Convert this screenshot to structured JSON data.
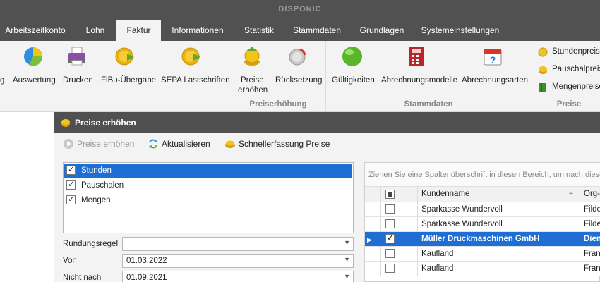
{
  "app": {
    "title": "DISPONIC"
  },
  "menu": {
    "tabs": [
      {
        "label": "Arbeitszeitkonto"
      },
      {
        "label": "Lohn"
      },
      {
        "label": "Faktur",
        "active": true
      },
      {
        "label": "Informationen"
      },
      {
        "label": "Statistik"
      },
      {
        "label": "Stammdaten"
      },
      {
        "label": "Grundlagen"
      },
      {
        "label": "Systemeinstellungen"
      }
    ]
  },
  "ribbon": {
    "buttons": [
      {
        "label": "g",
        "icon": "partial-icon"
      },
      {
        "label": "Auswertung",
        "icon": "pie-chart-icon"
      },
      {
        "label": "Drucken",
        "icon": "printer-icon"
      },
      {
        "label": "FiBu-Übergabe",
        "icon": "coin-transfer-icon"
      },
      {
        "label": "SEPA Lastschriften",
        "icon": "coin-export-icon"
      },
      {
        "label_line1": "Preise",
        "label_line2": "erhöhen",
        "icon": "coins-up-icon"
      },
      {
        "label": "Rücksetzung",
        "icon": "coin-reset-icon"
      },
      {
        "label": "Gültigkeiten",
        "icon": "green-ball-icon"
      },
      {
        "label": "Abrechnungsmodelle",
        "icon": "calculator-icon"
      },
      {
        "label": "Abrechnungsarten",
        "icon": "calendar-question-icon"
      }
    ],
    "groups": [
      {
        "label": "Preiserhöhung"
      },
      {
        "label": "Stammdaten"
      },
      {
        "label": "Preise"
      }
    ],
    "small_buttons": [
      {
        "label": "Stundenpreise",
        "icon": "coin-small-icon"
      },
      {
        "label": "Pauschalpreise",
        "icon": "coins-small-icon"
      },
      {
        "label": "Mengenpreise",
        "icon": "book-green-icon"
      }
    ],
    "colors": {
      "accent_blue": "#1f6ed3",
      "dark_bar": "#515151"
    }
  },
  "dialog": {
    "title": "Preise erhöhen",
    "toolbar": {
      "preise_erhoehen": "Preise erhöhen",
      "aktualisieren": "Aktualisieren",
      "schnellerfassung": "Schnellerfassung Preise"
    },
    "types": [
      {
        "label": "Stunden",
        "checked": true,
        "selected": true
      },
      {
        "label": "Pauschalen",
        "checked": true
      },
      {
        "label": "Mengen",
        "checked": true
      }
    ],
    "form": {
      "rundungsregel_label": "Rundungsregel",
      "rundungsregel_value": "",
      "von_label": "Von",
      "von_value": "01.03.2022",
      "nicht_nach_label": "Nicht nach",
      "nicht_nach_value": "01.09.2021"
    },
    "grid": {
      "group_hint": "Ziehen Sie eine Spaltenüberschrift in diesen Bereich, um nach dieser S",
      "headers": {
        "kundenname": "Kundenname",
        "org": "Org-"
      },
      "rows": [
        {
          "kundenname": "Sparkasse Wundervoll",
          "org": "Filde",
          "checked": false
        },
        {
          "kundenname": "Sparkasse Wundervoll",
          "org": "Filde",
          "checked": false
        },
        {
          "kundenname": "Müller Druckmaschinen GmbH",
          "org": "Dien",
          "checked": true,
          "selected": true
        },
        {
          "kundenname": "Kaufland",
          "org": "Fran",
          "checked": false
        },
        {
          "kundenname": "Kaufland",
          "org": "Fran",
          "checked": false
        }
      ]
    }
  }
}
